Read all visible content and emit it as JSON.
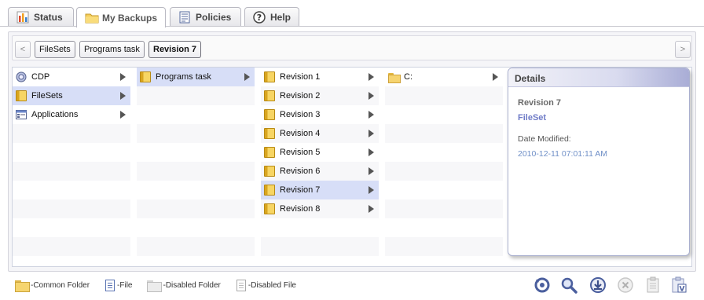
{
  "tabs": [
    {
      "label": "Status",
      "icon": "bar-chart-icon"
    },
    {
      "label": "My Backups",
      "icon": "folder-icon",
      "active": true
    },
    {
      "label": "Policies",
      "icon": "document-icon"
    },
    {
      "label": "Help",
      "icon": "question-icon"
    }
  ],
  "breadcrumb": {
    "prev": "<",
    "next": ">",
    "items": [
      "FileSets",
      "Programs task",
      "Revision 7"
    ]
  },
  "columns": {
    "col1": [
      {
        "label": "CDP",
        "icon": "cdp-icon"
      },
      {
        "label": "FileSets",
        "icon": "folder-icon",
        "selected": true
      },
      {
        "label": "Applications",
        "icon": "applications-icon"
      }
    ],
    "col2": [
      {
        "label": "Programs task",
        "icon": "folder-icon",
        "selected": true
      }
    ],
    "col3": [
      {
        "label": "Revision 1"
      },
      {
        "label": "Revision 2"
      },
      {
        "label": "Revision 3"
      },
      {
        "label": "Revision 4"
      },
      {
        "label": "Revision 5"
      },
      {
        "label": "Revision 6"
      },
      {
        "label": "Revision 7",
        "selected": true
      },
      {
        "label": "Revision 8"
      }
    ],
    "col4": [
      {
        "label": "C:",
        "icon": "folder-icon"
      }
    ]
  },
  "details": {
    "header": "Details",
    "name": "Revision 7",
    "type": "FileSet",
    "date_label": "Date Modified:",
    "date_value": "2010-12-11 07:01:11 AM"
  },
  "legend": [
    {
      "label": "-Common Folder",
      "icon": "common-folder-icon"
    },
    {
      "label": "-File",
      "icon": "file-icon"
    },
    {
      "label": "-Disabled Folder",
      "icon": "disabled-folder-icon"
    },
    {
      "label": "-Disabled File",
      "icon": "disabled-file-icon"
    }
  ],
  "toolbar": [
    "restore-icon",
    "search-icon",
    "download-icon",
    "delete-icon",
    "clipboard-icon",
    "verify-icon"
  ],
  "colors": {
    "selection": "#d7def7",
    "details_type": "#6f7bc7",
    "details_date": "#6f8fc7"
  }
}
